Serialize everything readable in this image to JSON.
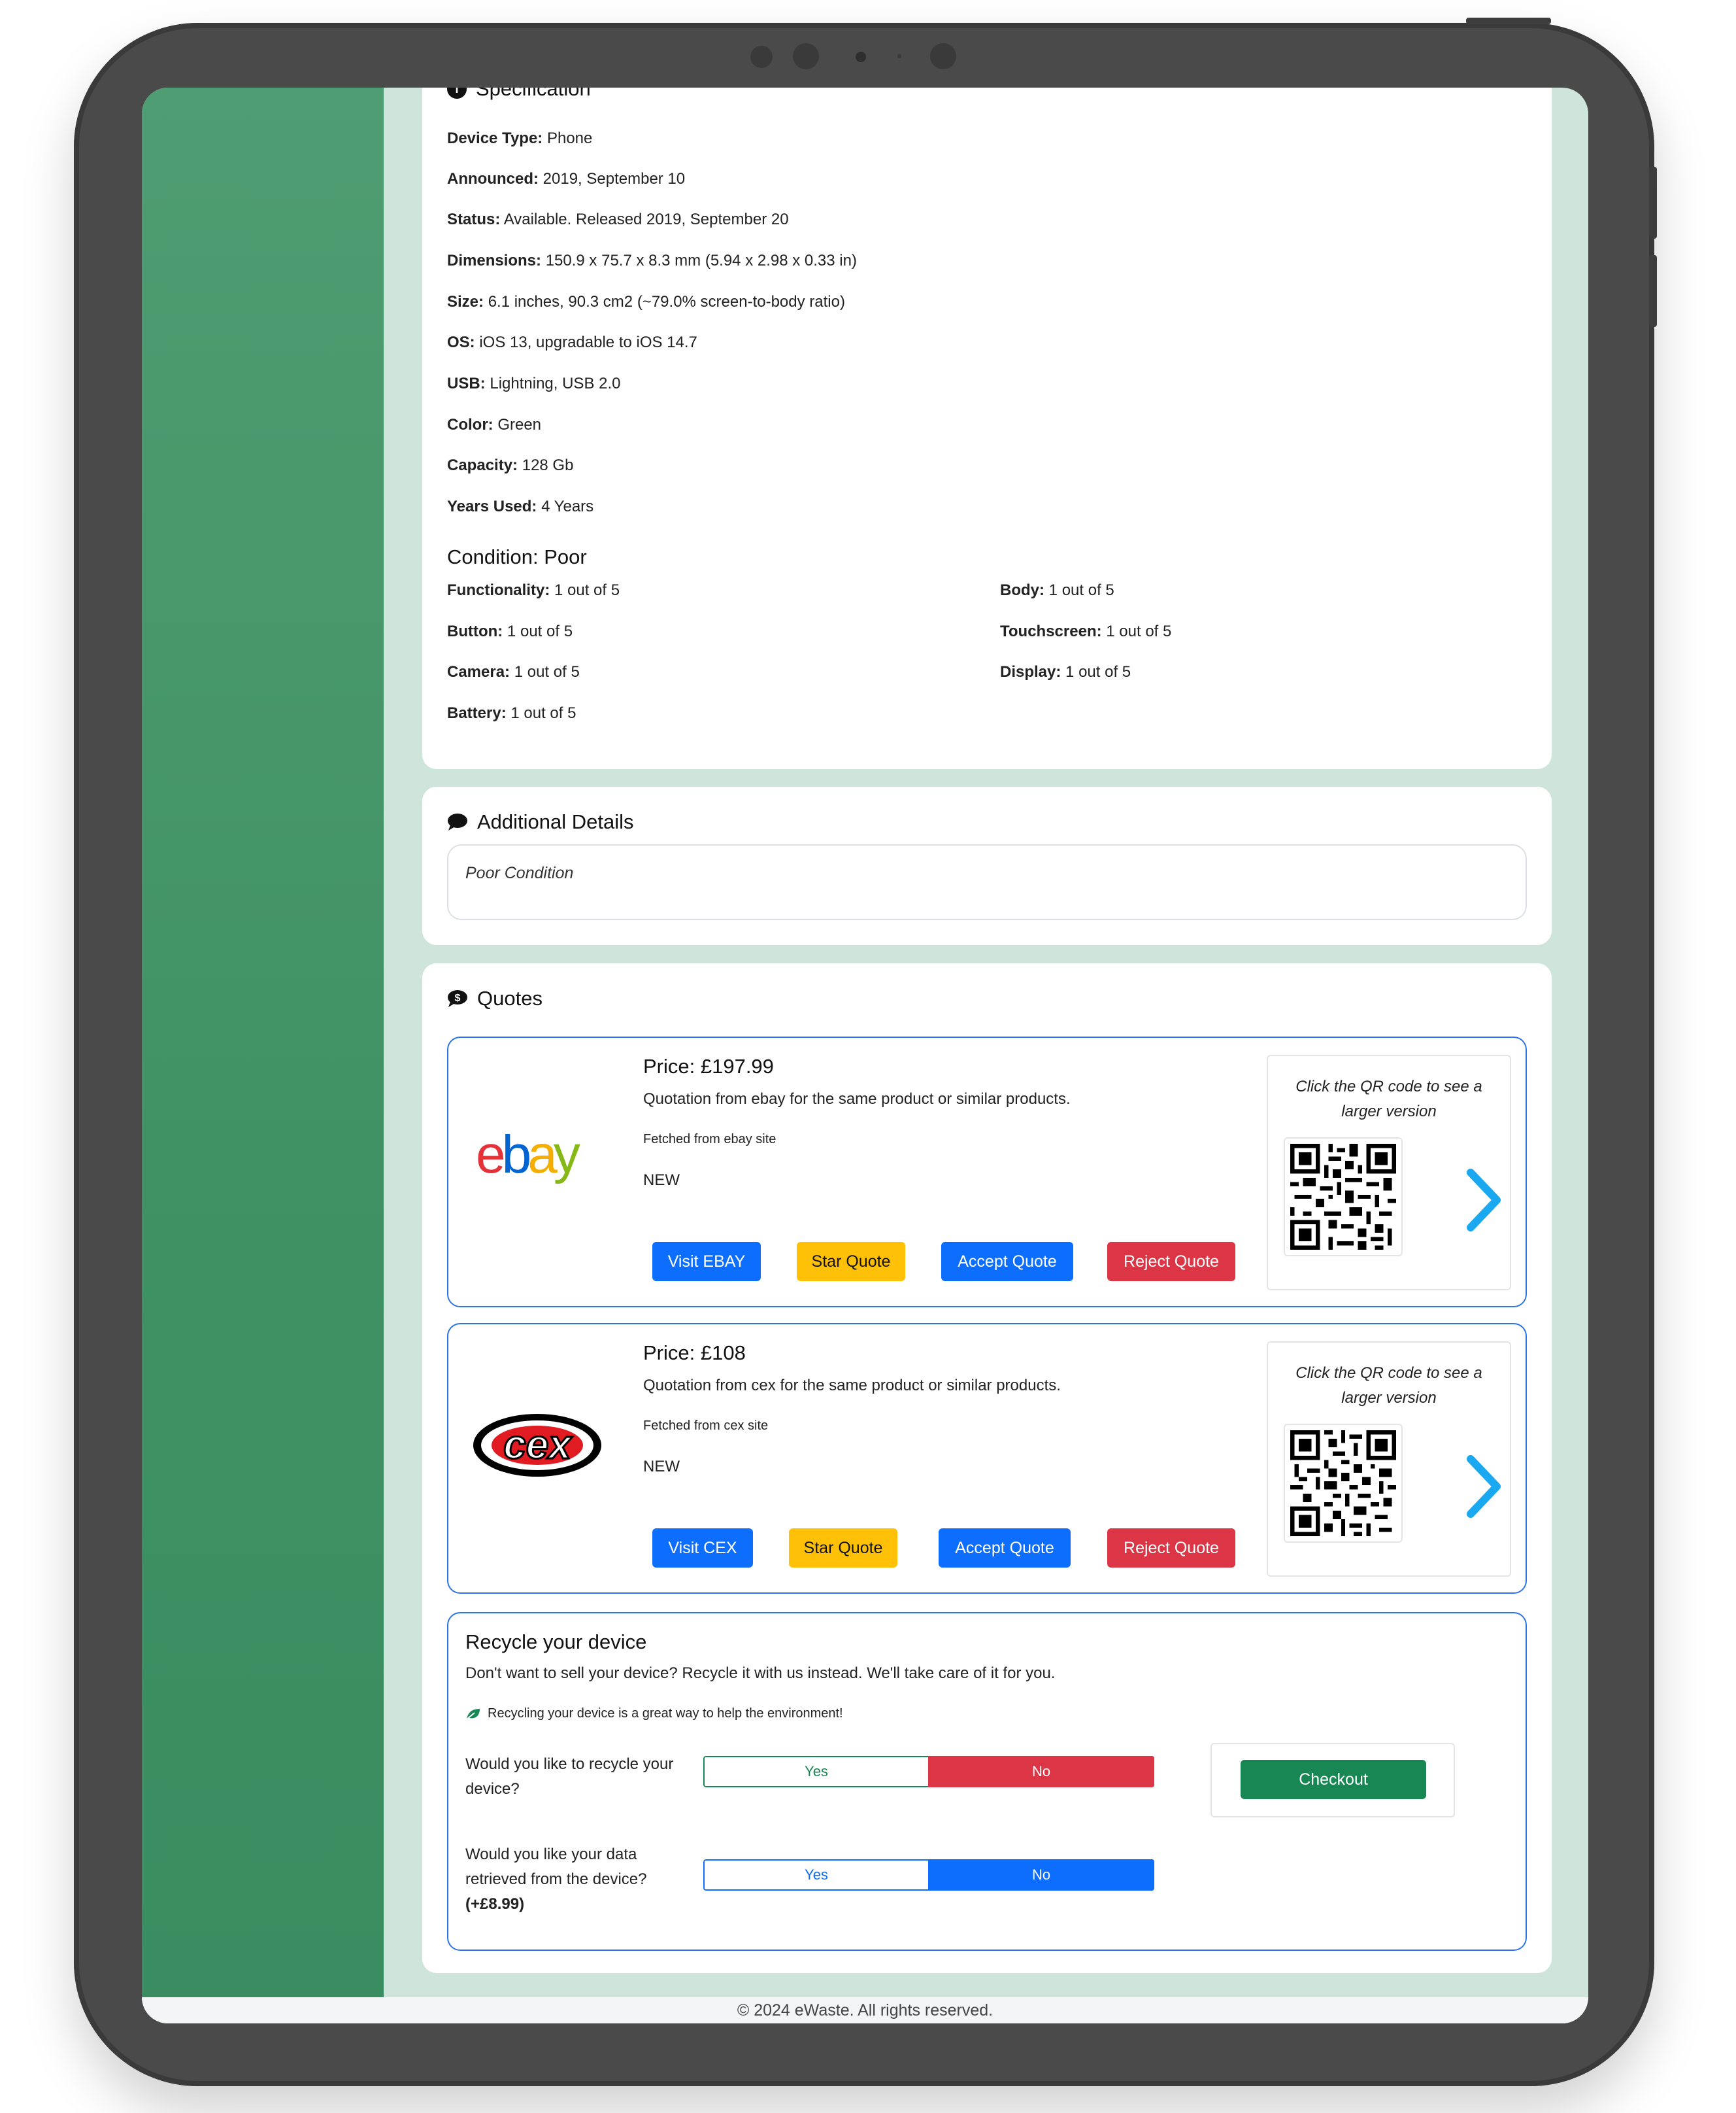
{
  "specification": {
    "title": "Specification",
    "rows": [
      {
        "label": "Device Type:",
        "value": "Phone"
      },
      {
        "label": "Announced:",
        "value": "2019, September 10"
      },
      {
        "label": "Status:",
        "value": "Available. Released 2019, September 20"
      },
      {
        "label": "Dimensions:",
        "value": "150.9 x 75.7 x 8.3 mm (5.94 x 2.98 x 0.33 in)"
      },
      {
        "label": "Size:",
        "value": "6.1 inches, 90.3 cm2 (~79.0% screen-to-body ratio)"
      },
      {
        "label": "OS:",
        "value": "iOS 13, upgradable to iOS 14.7"
      },
      {
        "label": "USB:",
        "value": "Lightning, USB 2.0"
      },
      {
        "label": "Color:",
        "value": "Green"
      },
      {
        "label": "Capacity:",
        "value": "128 Gb"
      },
      {
        "label": "Years Used:",
        "value": "4 Years"
      }
    ],
    "condition_title": "Condition: Poor",
    "condition": [
      {
        "label": "Functionality:",
        "value": "1 out of 5"
      },
      {
        "label": "Body:",
        "value": "1 out of 5"
      },
      {
        "label": "Button:",
        "value": "1 out of 5"
      },
      {
        "label": "Touchscreen:",
        "value": "1 out of 5"
      },
      {
        "label": "Camera:",
        "value": "1 out of 5"
      },
      {
        "label": "Display:",
        "value": "1 out of 5"
      },
      {
        "label": "Battery:",
        "value": "1 out of 5"
      }
    ]
  },
  "additional_details": {
    "title": "Additional Details",
    "text": "Poor Condition"
  },
  "quotes": {
    "title": "Quotes",
    "items": [
      {
        "logo": "ebay",
        "price": "Price: £197.99",
        "description": "Quotation from ebay for the same product or similar products.",
        "fetched": "Fetched from ebay site",
        "condition": "NEW",
        "visit_label": "Visit EBAY",
        "star_label": "Star Quote",
        "accept_label": "Accept Quote",
        "reject_label": "Reject Quote",
        "qr_caption": "Click the QR code to see a larger version"
      },
      {
        "logo": "cex",
        "price": "Price: £108",
        "description": "Quotation from cex for the same product or similar products.",
        "fetched": "Fetched from cex site",
        "condition": "NEW",
        "visit_label": "Visit CEX",
        "star_label": "Star Quote",
        "accept_label": "Accept Quote",
        "reject_label": "Reject Quote",
        "qr_caption": "Click the QR code to see a larger version"
      }
    ]
  },
  "recycle": {
    "title": "Recycle your device",
    "subtitle": "Don't want to sell your device? Recycle it with us instead. We'll take care of it for you.",
    "note": "Recycling your device is a great way to help the environment!",
    "q1": "Would you like to recycle your device?",
    "q1_yes": "Yes",
    "q1_no": "No",
    "q2": "Would you like your data retrieved from the device?",
    "q2_price": "(+£8.99)",
    "q2_yes": "Yes",
    "q2_no": "No",
    "checkout_label": "Checkout"
  },
  "footer": "© 2024 eWaste. All rights reserved.",
  "colors": {
    "sidebar": "#3f9163",
    "screen_bg": "#cfe5db",
    "primary": "#0d6efd",
    "warning": "#ffc107",
    "danger": "#dc3545",
    "success": "#198754"
  }
}
